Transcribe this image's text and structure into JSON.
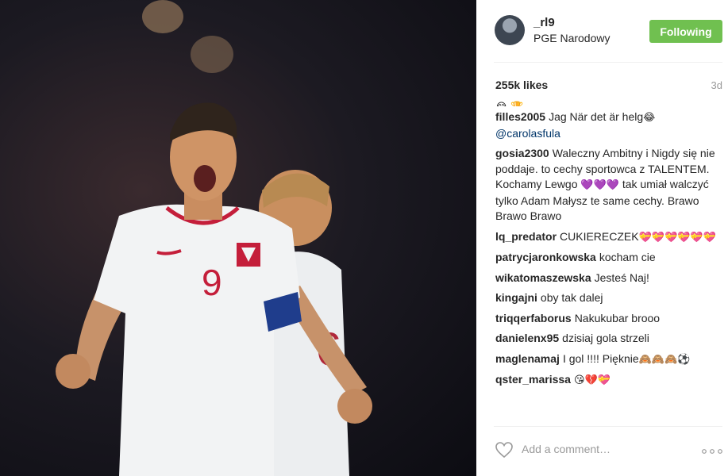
{
  "post": {
    "username": "_rl9",
    "location": "PGE Narodowy",
    "follow_label": "Following",
    "likes": "255k likes",
    "time": "3d",
    "partial_emoji": "😂 🏆"
  },
  "comments": [
    {
      "user": "filles2005",
      "text": "Jag När det är helg",
      "emoji": "😂",
      "mention": "@carolasfula"
    },
    {
      "user": "gosia2300",
      "text": "Waleczny Ambitny i Nigdy się nie poddaje. to cechy sportowca z TALENTEM. Kochamy Lewgo",
      "emoji": "💜💜💜",
      "text2": "tak umiał walczyć tylko Adam Małysz te same cechy. Brawo Brawo Brawo"
    },
    {
      "user": "lq_predator",
      "text": "CUKIERECZEK",
      "emoji": "💝💝💝💝💝💝"
    },
    {
      "user": "patrycjaronkowska",
      "text": "kocham cie"
    },
    {
      "user": "wikatomaszewska",
      "text": "Jesteś Naj!"
    },
    {
      "user": "kingajni",
      "text": "oby tak dalej"
    },
    {
      "user": "triqqerfaborus",
      "text": "Nakukubar brooo"
    },
    {
      "user": "danielenx95",
      "text": "dzisiaj gola strzeli"
    },
    {
      "user": "maglenamaj",
      "text": "I gol !!!! Pięknie",
      "emoji": "🙈🙈🙈⚽"
    },
    {
      "user": "qster_marissa",
      "text": "",
      "emoji": "😘💔💝"
    }
  ],
  "add_comment_placeholder": "Add a comment…",
  "colors": {
    "follow_button": "#70c050",
    "mention": "#003569",
    "muted": "#999999"
  },
  "icons": {
    "like": "heart-outline-icon",
    "more": "more-dots-icon"
  }
}
